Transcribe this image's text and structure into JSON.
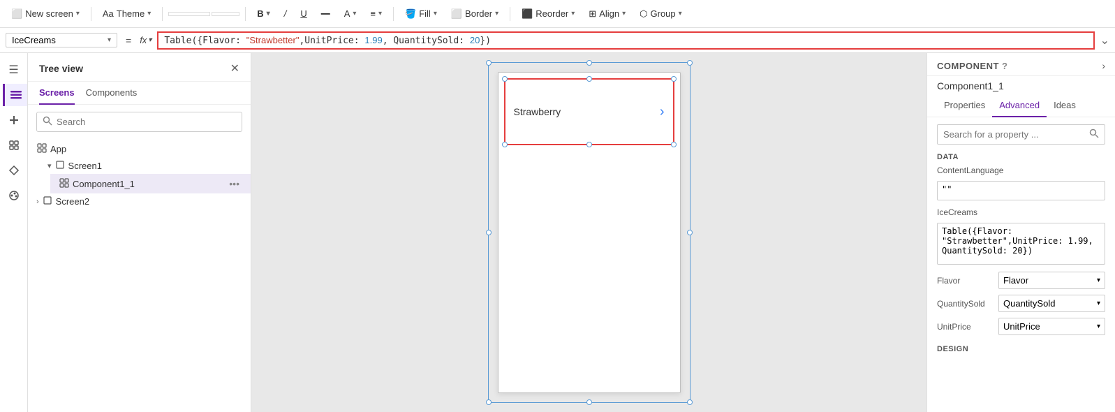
{
  "toolbar": {
    "new_screen_label": "New screen",
    "theme_label": "Theme",
    "bold_label": "B",
    "italic_label": "/",
    "underline_label": "U",
    "align_label": "A",
    "fill_label": "Fill",
    "border_label": "Border",
    "reorder_label": "Reorder",
    "align2_label": "Align",
    "group_label": "Group"
  },
  "formula_bar": {
    "selector_text": "IceCreams",
    "equals_symbol": "=",
    "fx_label": "fx",
    "formula_prefix": "Table({Flavor: ",
    "formula_string": "\"Strawbetter\"",
    "formula_mid": ",UnitPrice: ",
    "formula_num1": "1.99",
    "formula_mid2": ", QuantitySold: ",
    "formula_num2": "20",
    "formula_suffix": "})"
  },
  "tree_view": {
    "title": "Tree view",
    "tabs": [
      "Screens",
      "Components"
    ],
    "active_tab": "Screens",
    "search_placeholder": "Search",
    "add_label": "+ App",
    "items": [
      {
        "id": "screen1",
        "label": "Screen1",
        "type": "screen",
        "expanded": true,
        "indent": 0
      },
      {
        "id": "component1_1",
        "label": "Component1_1",
        "type": "component",
        "indent": 1,
        "selected": true
      },
      {
        "id": "screen2",
        "label": "Screen2",
        "type": "screen",
        "expanded": false,
        "indent": 0
      }
    ]
  },
  "canvas": {
    "component_text": "Strawberry",
    "arrow_symbol": "›"
  },
  "right_panel": {
    "section_label": "COMPONENT",
    "title": "Component1_1",
    "tabs": [
      "Properties",
      "Advanced",
      "Ideas"
    ],
    "active_tab": "Advanced",
    "search_placeholder": "Search for a property ...",
    "data_section": "DATA",
    "content_language_label": "ContentLanguage",
    "content_language_value": "\"\"",
    "ice_creams_label": "IceCreams",
    "ice_creams_value": "Table({Flavor:\n\"Strawbetter\",UnitPrice: 1.99,\nQuantitySold: 20})",
    "flavor_label": "Flavor",
    "flavor_value": "Flavor",
    "quantity_sold_label": "QuantitySold",
    "quantity_sold_value": "QuantitySold",
    "unit_price_label": "UnitPrice",
    "unit_price_value": "UnitPrice",
    "design_section": "DESIGN"
  },
  "sidebar_icons": {
    "icons": [
      {
        "name": "menu-icon",
        "symbol": "≡"
      },
      {
        "name": "layers-icon",
        "symbol": "⬡"
      },
      {
        "name": "plus-icon",
        "symbol": "+"
      },
      {
        "name": "cursor-icon",
        "symbol": "⊕"
      },
      {
        "name": "data-icon",
        "symbol": "⊞"
      },
      {
        "name": "components-icon",
        "symbol": "⊡"
      },
      {
        "name": "paint-icon",
        "symbol": "🎨"
      }
    ]
  }
}
